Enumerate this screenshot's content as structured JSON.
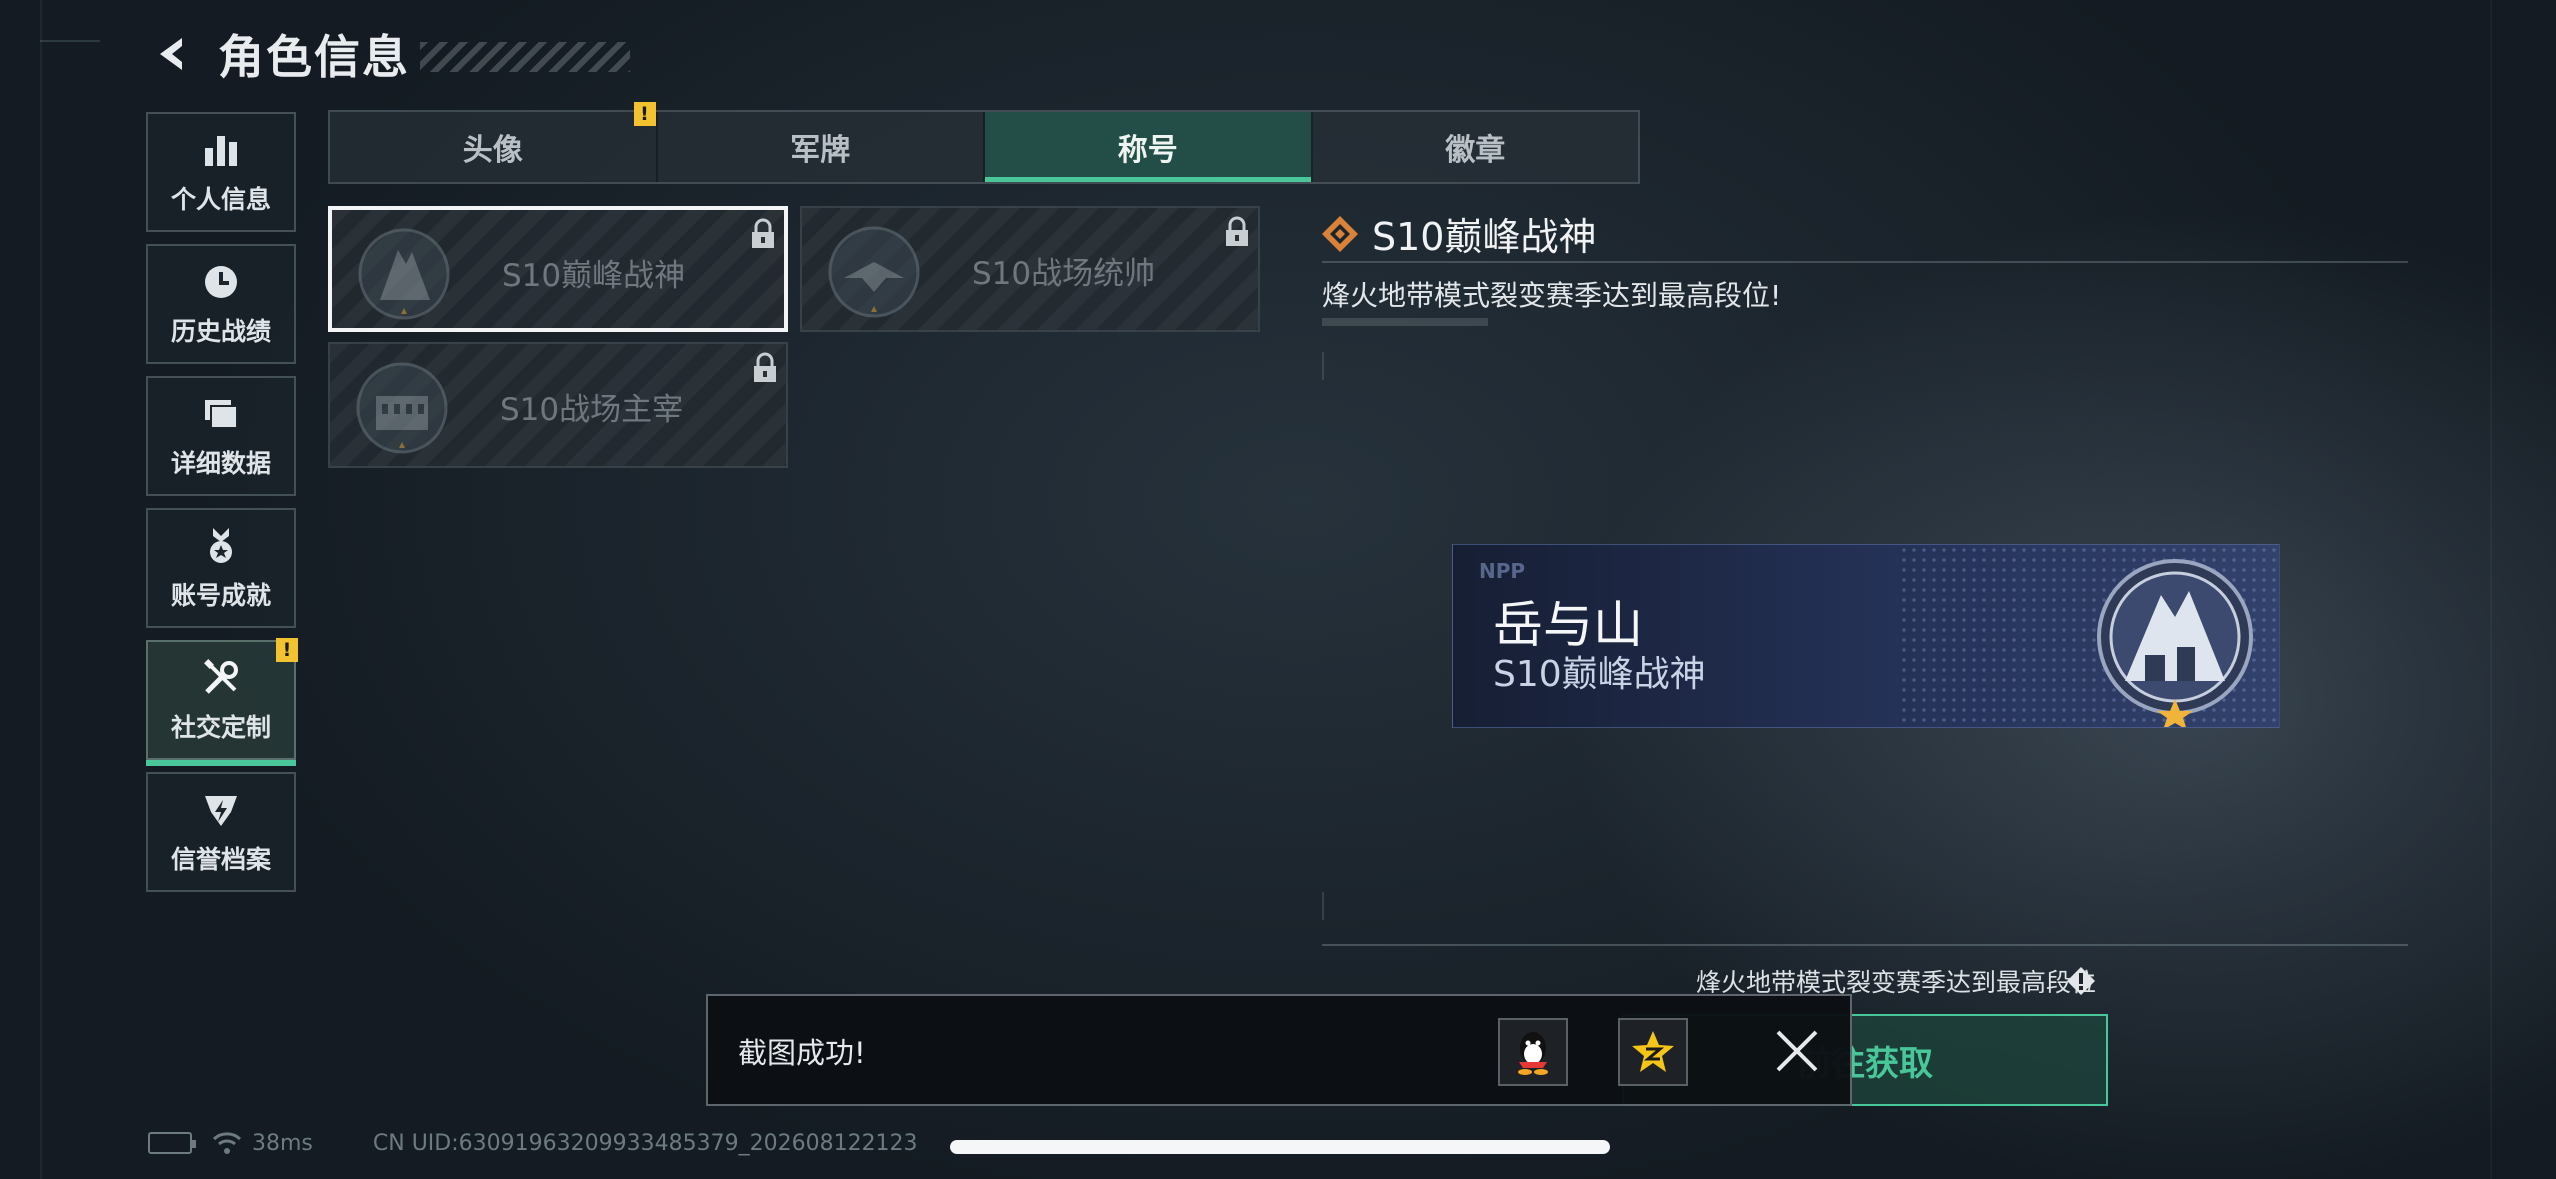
{
  "header": {
    "title": "角色信息",
    "back_icon": "chevron-left-icon"
  },
  "sidebar": {
    "items": [
      {
        "label": "个人信息",
        "icon": "bar-chart-icon",
        "active": false,
        "alert": false
      },
      {
        "label": "历史战绩",
        "icon": "clock-icon",
        "active": false,
        "alert": false
      },
      {
        "label": "详细数据",
        "icon": "folder-icon",
        "active": false,
        "alert": false
      },
      {
        "label": "账号成就",
        "icon": "medal-icon",
        "active": false,
        "alert": false
      },
      {
        "label": "社交定制",
        "icon": "tools-icon",
        "active": true,
        "alert": true,
        "alert_mark": "!"
      },
      {
        "label": "信誉档案",
        "icon": "shield-bolt-icon",
        "active": false,
        "alert": false
      }
    ]
  },
  "tabs": [
    {
      "label": "头像",
      "active": false,
      "alert": true,
      "alert_mark": "!"
    },
    {
      "label": "军牌",
      "active": false,
      "alert": false
    },
    {
      "label": "称号",
      "active": true,
      "alert": false
    },
    {
      "label": "徽章",
      "active": false,
      "alert": false
    }
  ],
  "titles": [
    {
      "label": "S10巅峰战神",
      "selected": true,
      "locked": true,
      "emblem": "mountain-emblem-icon"
    },
    {
      "label": "S10战场统帅",
      "selected": false,
      "locked": true,
      "emblem": "jet-emblem-icon"
    },
    {
      "label": "S10战场主宰",
      "selected": false,
      "locked": true,
      "emblem": "colosseum-emblem-icon"
    }
  ],
  "detail": {
    "name": "S10巅峰战神",
    "description": "烽火地带模式裂变赛季达到最高段位!"
  },
  "banner": {
    "logo": "NPP",
    "player_name": "岳与山",
    "title": "S10巅峰战神"
  },
  "requirement": {
    "text": "烽火地带模式裂变赛季达到最高段位",
    "icon": "info-diamond-icon"
  },
  "action_button": {
    "label": "前往获取"
  },
  "toast": {
    "message": "截图成功!",
    "share_icons": [
      "qq-icon",
      "qzone-icon"
    ],
    "close_icon": "close-icon"
  },
  "status": {
    "ping": "38ms",
    "uid": "CN UID:63091963209933485379_202608122123"
  },
  "colors": {
    "accent": "#49c79a",
    "alert": "#f2c230",
    "banner": "#26345c"
  }
}
